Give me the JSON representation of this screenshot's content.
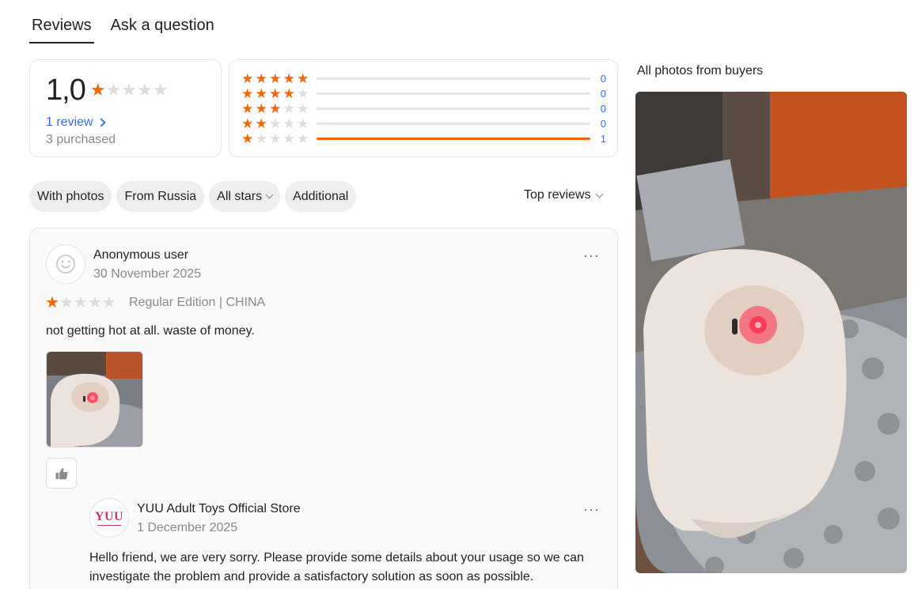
{
  "tabs": [
    {
      "label": "Reviews",
      "active": true
    },
    {
      "label": "Ask a question",
      "active": false
    }
  ],
  "summary": {
    "rating": "1,0",
    "rating_value": 1,
    "max_stars": 5,
    "reviews_link": "1 review",
    "purchased": "3 purchased"
  },
  "distribution": [
    {
      "stars": 5,
      "count": "0",
      "share": 0
    },
    {
      "stars": 4,
      "count": "0",
      "share": 0
    },
    {
      "stars": 3,
      "count": "0",
      "share": 0
    },
    {
      "stars": 2,
      "count": "0",
      "share": 0
    },
    {
      "stars": 1,
      "count": "1",
      "share": 1
    }
  ],
  "filters": {
    "with_photos": "With photos",
    "from_russia": "From Russia",
    "all_stars": "All stars",
    "additional": "Additional"
  },
  "sort": {
    "label": "Top reviews"
  },
  "review": {
    "author": "Anonymous user",
    "date": "30 November 2025",
    "stars": 1,
    "variant": "Regular Edition | CHINA",
    "text": "not getting hot at all. waste of money.",
    "more": "···",
    "reply": {
      "store_logo": "YUU",
      "store_name": "YUU Adult Toys Official Store",
      "date": "1 December 2025",
      "text": "Hello friend, we are very sorry. Please provide some details about your usage so we can investigate the problem and provide a satisfactory solution as soon as possible."
    }
  },
  "photos": {
    "title": "All photos from buyers"
  },
  "colors": {
    "accent": "#f5650a",
    "link": "#3a6ee8",
    "star_off": "#dcdcdc"
  }
}
